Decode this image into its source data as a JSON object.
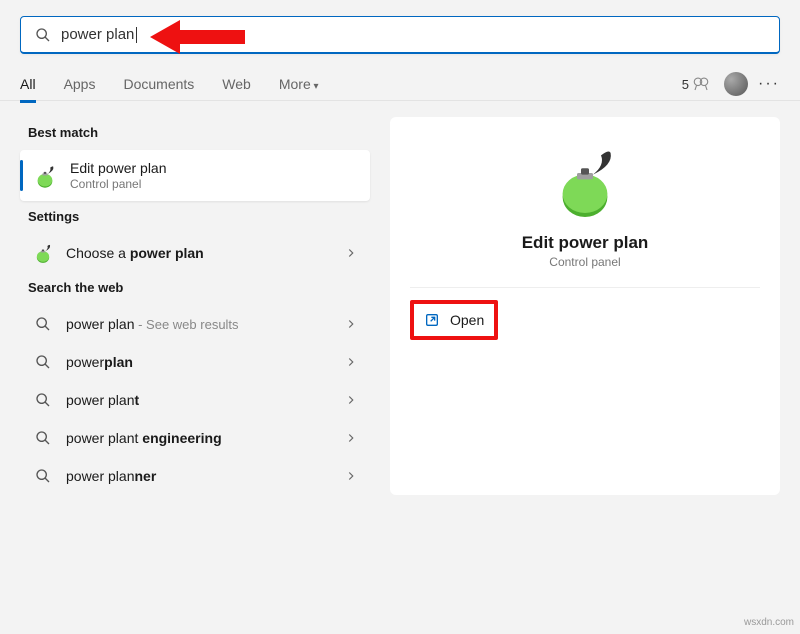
{
  "search": {
    "query": "power plan"
  },
  "tabs": [
    "All",
    "Apps",
    "Documents",
    "Web",
    "More"
  ],
  "active_tab": 0,
  "points": "5",
  "sections": {
    "best_match": "Best match",
    "settings": "Settings",
    "web": "Search the web"
  },
  "best_result": {
    "title": "Edit power plan",
    "subtitle": "Control panel"
  },
  "settings_results": [
    {
      "html": "Choose a <strong>power plan</strong>"
    }
  ],
  "web_results": [
    {
      "html": "power plan",
      "suffix": " - See web results"
    },
    {
      "html": "power<strong>plan</strong>"
    },
    {
      "html": "power plan<strong>t</strong>"
    },
    {
      "html": "power plant <strong>engineering</strong>"
    },
    {
      "html": "power plan<strong>ner</strong>"
    }
  ],
  "detail": {
    "title": "Edit power plan",
    "subtitle": "Control panel",
    "open_label": "Open"
  },
  "watermark": "wsxdn.com"
}
